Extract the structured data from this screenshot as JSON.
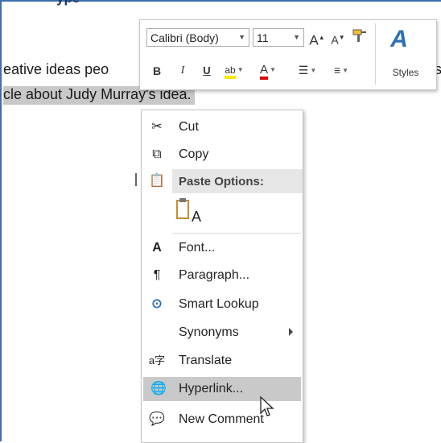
{
  "document": {
    "heading_fragment": "ype",
    "line1_text": "eative ideas peo",
    "line1_tail": "s",
    "line2_text": "cle about Judy Murray's idea."
  },
  "mini_toolbar": {
    "font_name": "Calibri (Body)",
    "font_size": "11",
    "grow_font": "A",
    "shrink_font": "A",
    "bold": "B",
    "italic": "I",
    "underline": "U",
    "highlight": "ab",
    "font_color": "A",
    "styles_icon": "A",
    "styles_label": "Styles"
  },
  "context_menu": {
    "items": [
      {
        "label": "Cut",
        "icon": "scissors-icon"
      },
      {
        "label": "Copy",
        "icon": "copy-icon"
      },
      {
        "label": "Paste Options:",
        "icon": "paste-icon"
      },
      {
        "label": "Font...",
        "icon": "font-icon"
      },
      {
        "label": "Paragraph...",
        "icon": "paragraph-icon"
      },
      {
        "label": "Smart Lookup",
        "icon": "smart-lookup-icon"
      },
      {
        "label": "Synonyms",
        "icon": ""
      },
      {
        "label": "Translate",
        "icon": "translate-icon"
      },
      {
        "label": "Hyperlink...",
        "icon": "hyperlink-icon"
      },
      {
        "label": "New Comment",
        "icon": "new-comment-icon"
      }
    ],
    "paste_option_glyph": "A",
    "highlighted_item": "Hyperlink..."
  },
  "colors": {
    "accent_blue": "#2d6fb7",
    "highlight_yellow": "#ffe600",
    "font_color_red": "#e00000",
    "selection_gray": "#c8c8c8"
  }
}
